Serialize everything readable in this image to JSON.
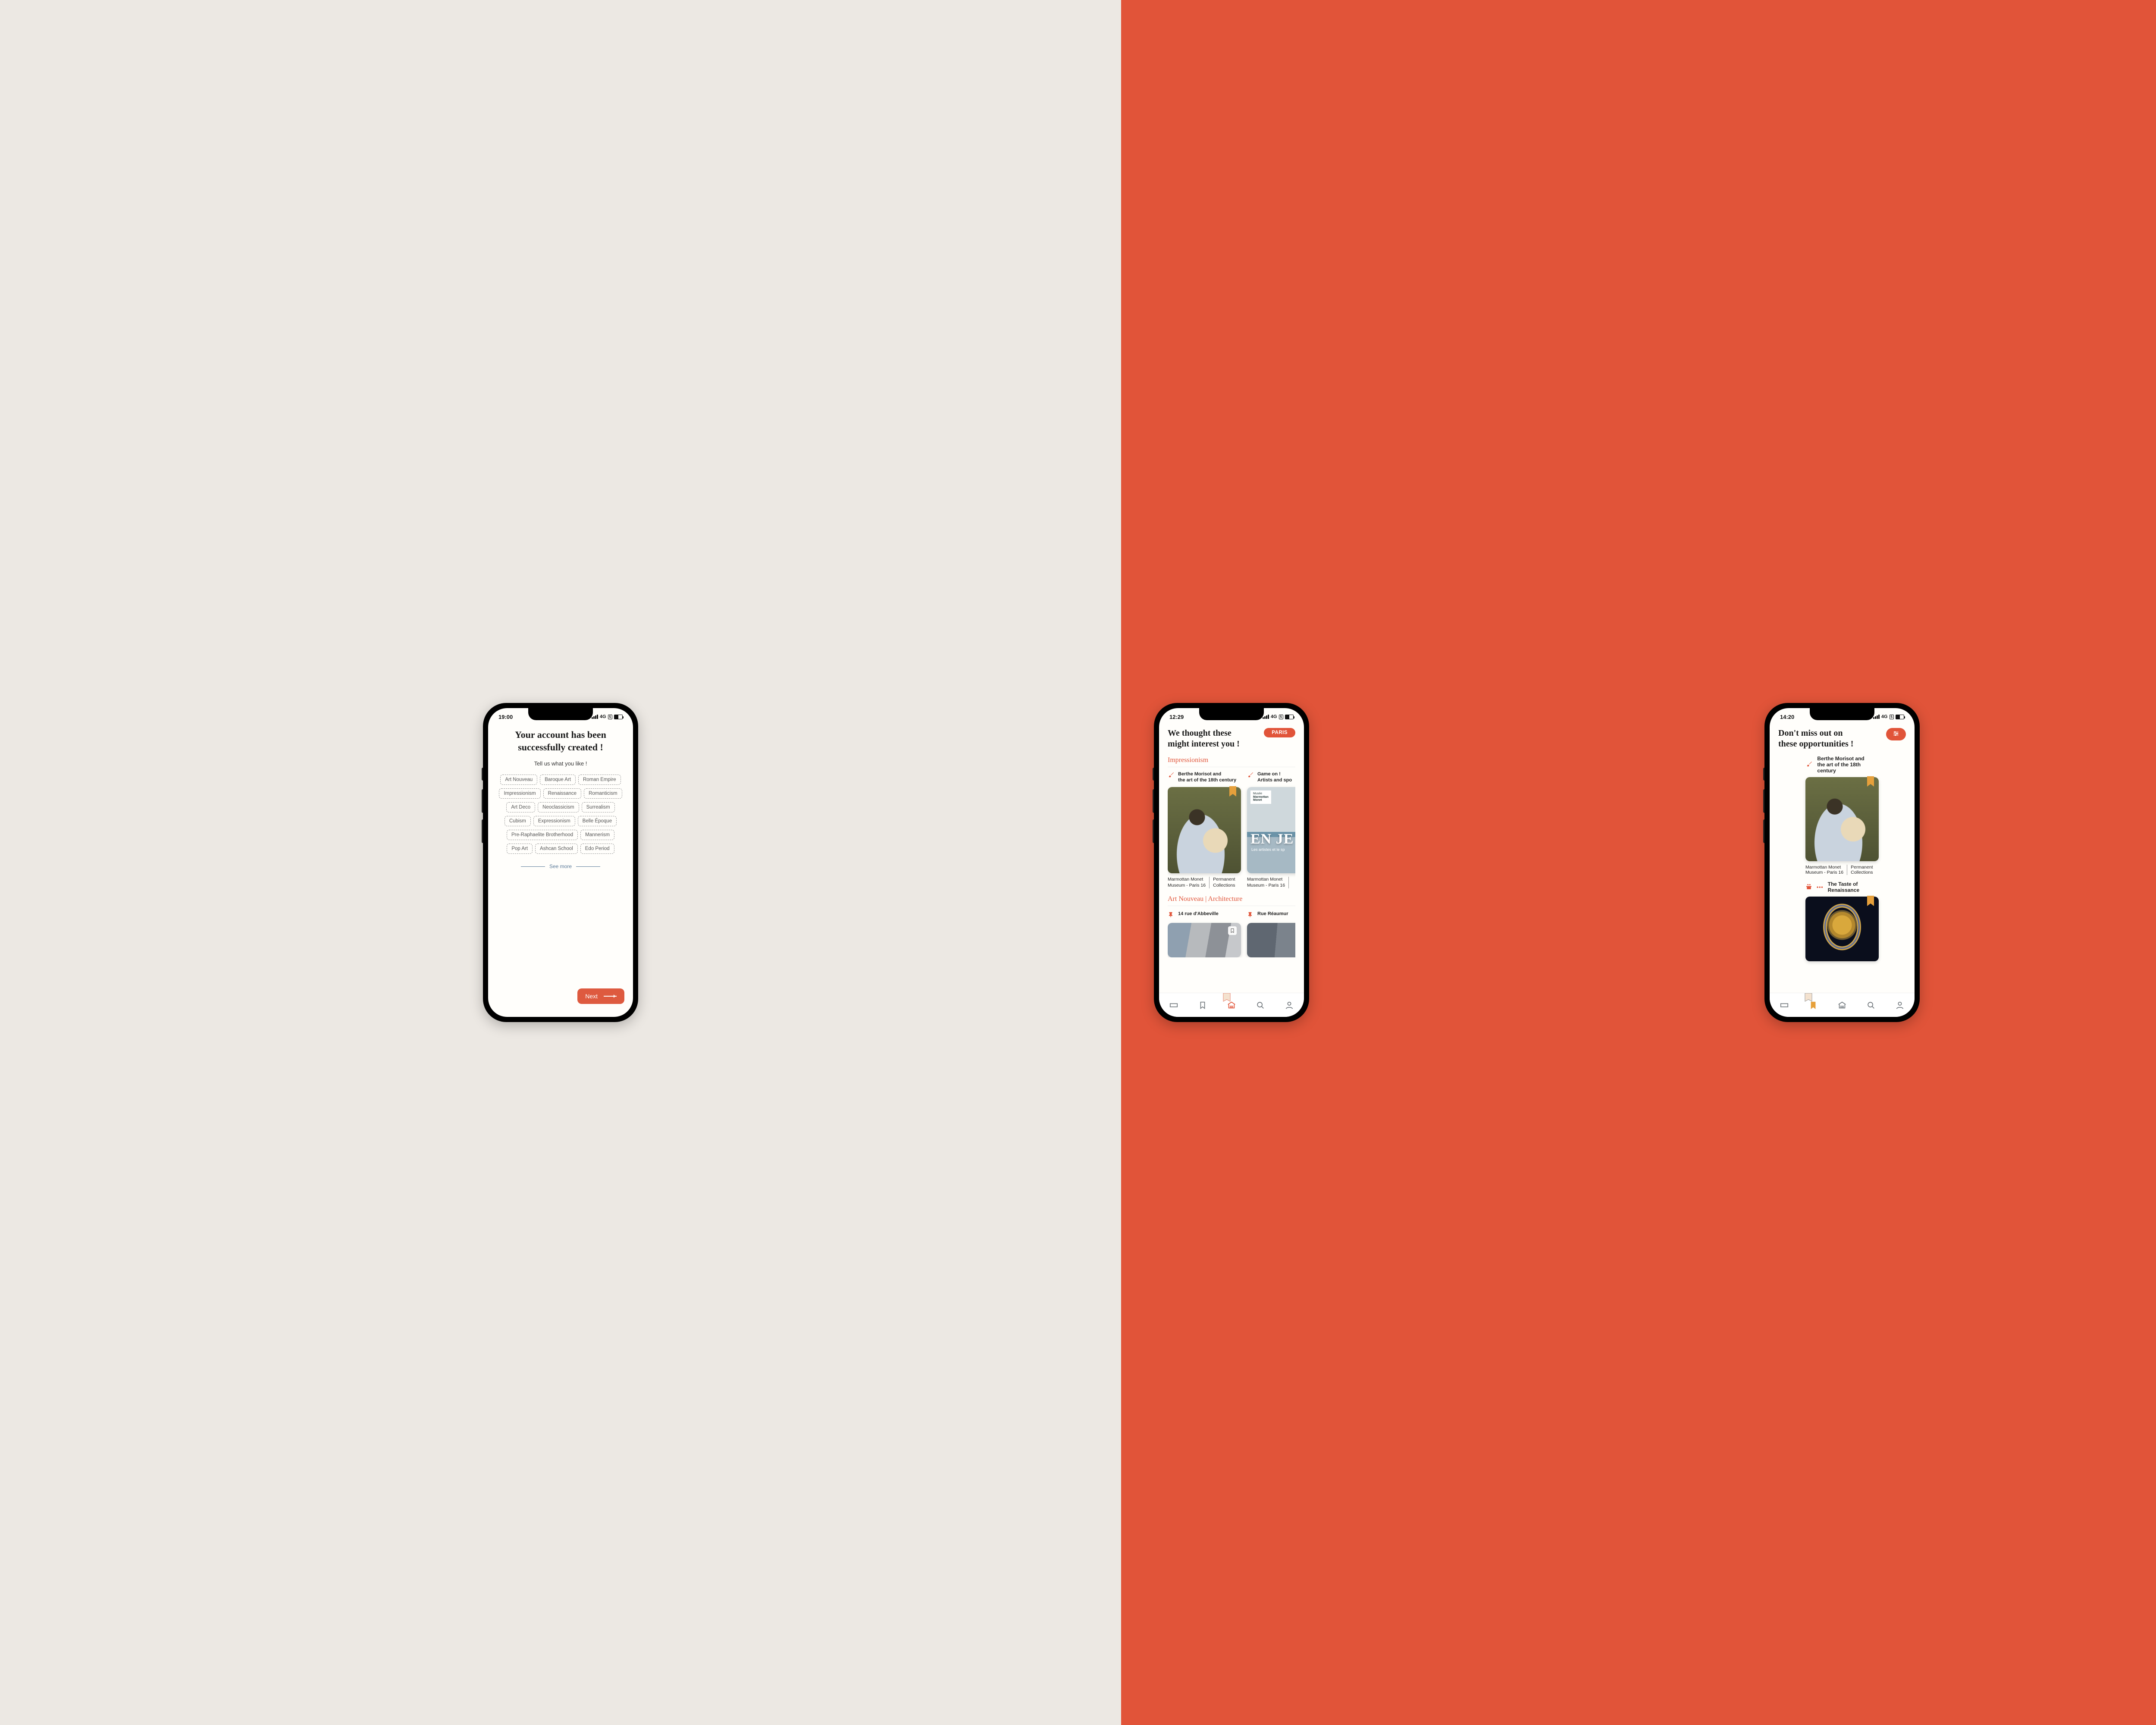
{
  "colors": {
    "accent": "#e15439",
    "bg_left": "#ece8e3"
  },
  "screen1": {
    "status_time": "19:00",
    "status_net": "4G",
    "title_l1": "Your account has been",
    "title_l2": "successfully created !",
    "subtitle": "Tell us what you like !",
    "chips": [
      "Art Nouveau",
      "Baroque Art",
      "Roman Empire",
      "Impressionism",
      "Renaissance",
      "Romanticism",
      "Art Deco",
      "Neoclassicism",
      "Surrealism",
      "Cubism",
      "Expressionism",
      "Belle Époque",
      "Pre-Raphaelite Brotherhood",
      "Mannerism",
      "Pop Art",
      "Ashcan School",
      "Edo Period"
    ],
    "see_more": "See more",
    "next": "Next"
  },
  "screen2": {
    "status_time": "12:29",
    "status_net": "4G",
    "title_l1": "We thought these",
    "title_l2": "might interest you !",
    "city_pill": "PARIS",
    "section1": "Impressionism",
    "s1_card1": {
      "title_l1": "Berthe Morisot and",
      "title_l2": "the art of the 18th century",
      "foot_a_l1": "Marmottan Monet",
      "foot_a_l2": "Museum - Paris 16",
      "foot_b_l1": "Permanent",
      "foot_b_l2": "Collections"
    },
    "s1_card2": {
      "title_l1": "Game on !",
      "title_l2": "Artists and spo",
      "plaque_l1": "Musée",
      "plaque_l2": "Marmottan",
      "plaque_l3": "Monet",
      "foot_a_l1": "Marmottan Monet",
      "foot_a_l2": "Museum - Paris 16"
    },
    "section2": "Art Nouveau | Architecture",
    "s2_card1": {
      "title": "14 rue d'Abbeville"
    },
    "s2_card2": {
      "title": "Rue Réaumur"
    }
  },
  "screen3": {
    "status_time": "14:20",
    "status_net": "4G",
    "title_l1": "Don't miss out on",
    "title_l2": "these opportunities !",
    "card1": {
      "title_l1": "Berthe Morisot and",
      "title_l2": "the art of the 18th century",
      "foot_a_l1": "Marmottan Monet",
      "foot_a_l2": "Museum - Paris 16",
      "foot_b_l1": "Permanent",
      "foot_b_l2": "Collections"
    },
    "card2": {
      "title": "The Taste of Renaissance"
    }
  },
  "nav": {
    "items": [
      "ticket",
      "bookmark",
      "museum",
      "search",
      "profile"
    ]
  }
}
